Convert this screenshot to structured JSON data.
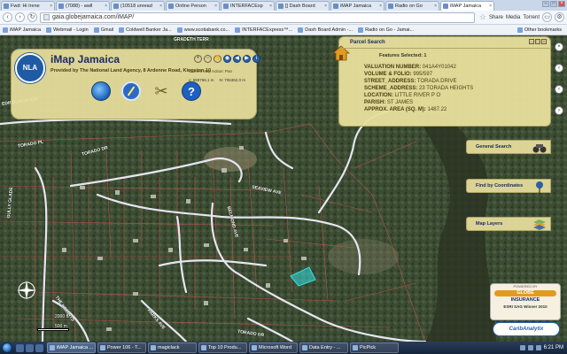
{
  "browser": {
    "tabs": [
      {
        "label": "Fwd: Hi Irene",
        "active": false
      },
      {
        "label": "(7088) - awll",
        "active": false
      },
      {
        "label": "(10518 unread",
        "active": false
      },
      {
        "label": "Online Person",
        "active": false
      },
      {
        "label": "INTERFACExp",
        "active": false
      },
      {
        "label": "[] Dash Board",
        "active": false
      },
      {
        "label": "iMAP Jamaica",
        "active": false
      },
      {
        "label": "Radio on Go",
        "active": false
      },
      {
        "label": "iMAP Jamaica",
        "active": true
      }
    ],
    "address_url": "gaia.globejamaica.com/iMAP/",
    "toolbar_items": {
      "share": "Share",
      "media": "Media",
      "torrent": "Torrent"
    },
    "bookmarks": [
      "iMAP Jamaica",
      "Webmail - Login",
      "Gmail",
      "Coldwell Banker Ja...",
      "www.scotiabank.co...",
      "INTERFACExpress™...",
      "Dash Board Admin -...",
      "Radio on Go - Jamai..."
    ],
    "other_bookmarks": "Other bookmarks"
  },
  "header": {
    "logo_text": "NLA",
    "title": "iMap Jamaica",
    "subtitle": "Provided by The National Land Agency, 8 Ardenne Road, Kingston 10",
    "current_map_action": "Current Map Action: Pan",
    "coord_x": "x: 659766.1 m",
    "coord_y": "N: 706362.0 m"
  },
  "parcel_search": {
    "title": "Parcel Search",
    "features_selected": "Features Selected: 1",
    "rows": [
      {
        "key": "VALUATION NUMBER:",
        "value": "041A4Y01042"
      },
      {
        "key": "VOLUME & FOLIO:",
        "value": "995/597"
      },
      {
        "key": "STREET_ADDRESS:",
        "value": "TORADA DRIVE"
      },
      {
        "key": "SCHEME_ADDRESS:",
        "value": "23 TORADA HEIGHTS"
      },
      {
        "key": "LOCATION:",
        "value": "LITTLE RIVER P O"
      },
      {
        "key": "PARISH:",
        "value": "ST JAMES"
      },
      {
        "key": "APPROX. AREA (SQ. M):",
        "value": "1487.22"
      }
    ]
  },
  "side_panels": {
    "general_search": "General Search",
    "find_by_coordinates": "Find by Coordinates",
    "map_layers": "Map Layers"
  },
  "road_labels": {
    "gradeth_terr": "GRADETH TERR",
    "edinburgh_ave": "EDINBURGH AVE",
    "torado_pl": "TORADO PL",
    "torado_dr": "TORADO DR",
    "seaview_ave": "SEAVIEW AVE",
    "belmond_ave": "BELMOND AVE",
    "gully_glade": "GULLY GLADE",
    "torado_dr_2": "TORADO DR",
    "the_heights": "THE HEIGHTS",
    "parks_ave": "PARKS AVE"
  },
  "map": {
    "scale_label_top": "2000 ft",
    "scale_label_bottom": "500 m"
  },
  "badges": {
    "powered_by": "POWERED BY",
    "globe": "GLOBE",
    "insurance": "INSURANCE",
    "esri": "ESRI SAG Winner 2010",
    "carib": "CaribAnalytix"
  },
  "taskbar": {
    "items": [
      {
        "label": "iMAP Jamaica ...",
        "active": true
      },
      {
        "label": "Power 106 - T...",
        "active": false
      },
      {
        "label": "magiclack",
        "active": false
      },
      {
        "label": "Top 10 Produ...",
        "active": false
      },
      {
        "label": "Microsoft Word",
        "active": false
      },
      {
        "label": "Data Entry - ...",
        "active": false
      },
      {
        "label": "PicPick",
        "active": false
      }
    ],
    "time": "6:21 PM"
  },
  "colors": {
    "panel_bg": "#e8df9c",
    "title_blue": "#1d2a66",
    "parcel_highlight": "#33e0e0",
    "road_color": "#e6e6f0",
    "parcel_line": "#c0564b"
  }
}
